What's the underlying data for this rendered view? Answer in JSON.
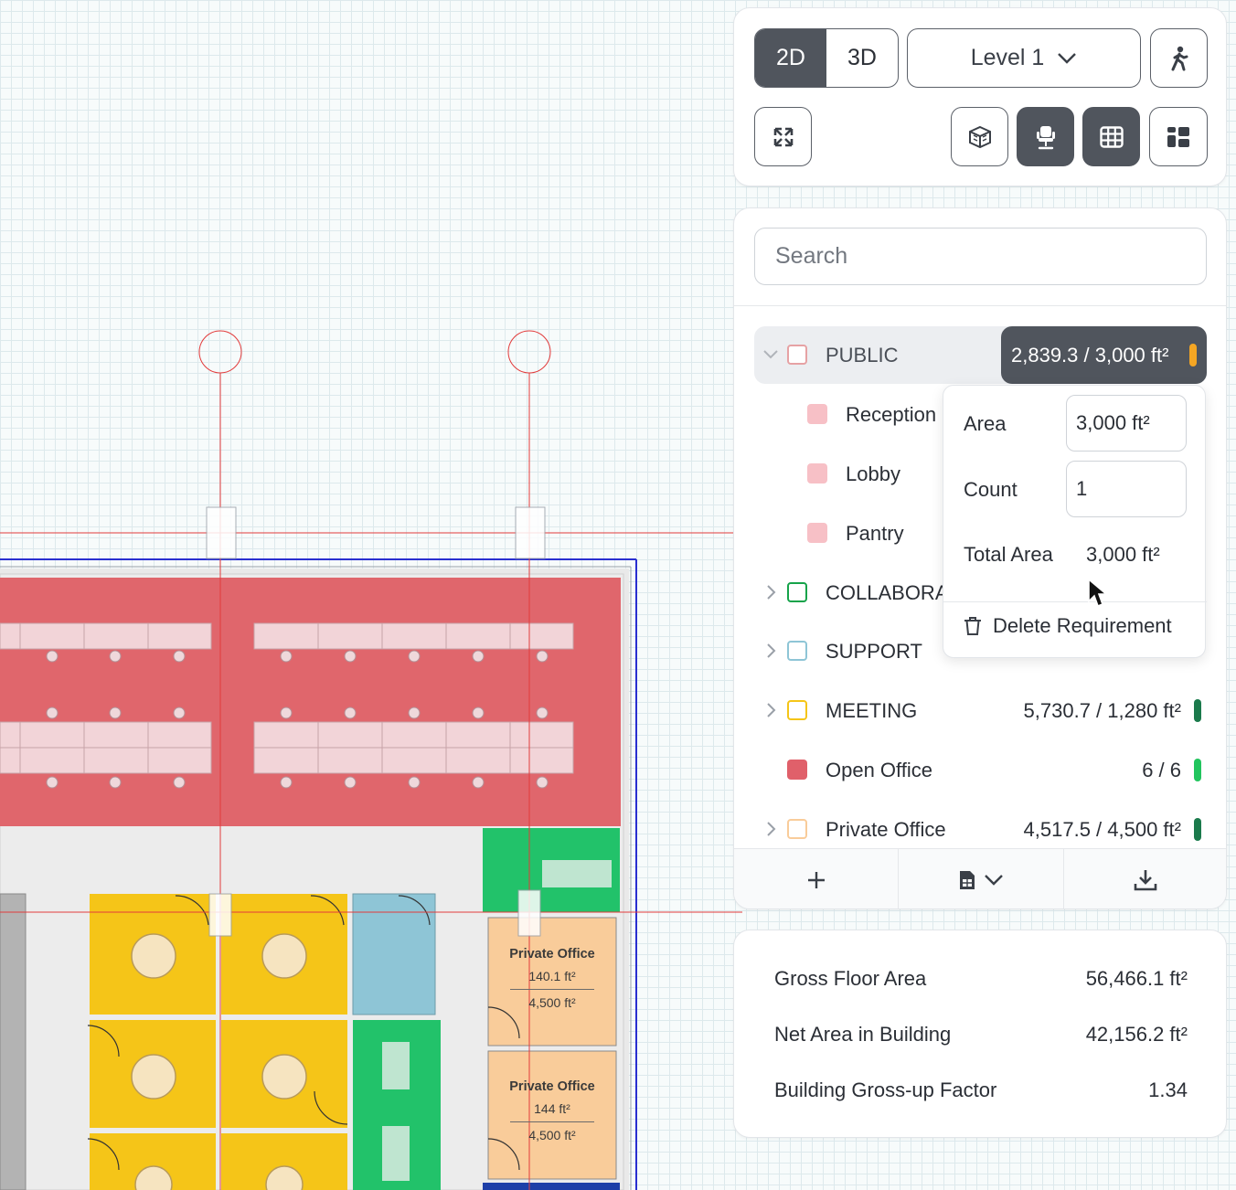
{
  "plan": {
    "labels": [
      {
        "title": "Private Office",
        "actual": "140.1 ft²",
        "target": "4,500 ft²"
      },
      {
        "title": "Private Office",
        "actual": "144 ft²",
        "target": "4,500 ft²"
      }
    ]
  },
  "toolbar": {
    "view_2d": "2D",
    "view_3d": "3D",
    "level": "Level 1",
    "icons": [
      "walk-icon",
      "expand-icon",
      "cube-icon",
      "chair-icon",
      "grid-icon",
      "layout-icon"
    ]
  },
  "search": {
    "placeholder": "Search"
  },
  "list": {
    "public": {
      "label": "PUBLIC",
      "value": "2,839.3 / 3,000 ft²",
      "swatch": "#e6a2a4",
      "bar": "#f5a623"
    },
    "children": [
      {
        "label": "Reception",
        "swatch": "#f7c0c6"
      },
      {
        "label": "Lobby",
        "swatch": "#f7c0c6"
      },
      {
        "label": "Pantry",
        "swatch": "#f7c0c6"
      }
    ],
    "collaboration": {
      "label": "COLLABORA",
      "swatch": "#16a34a"
    },
    "support": {
      "label": "SUPPORT",
      "swatch": "#8ec5d6"
    },
    "meeting": {
      "label": "MEETING",
      "value": "5,730.7 / 1,280 ft²",
      "swatch": "#f5c518",
      "bar": "#1b7a4c"
    },
    "open_office": {
      "label": "Open Office",
      "value": "6 / 6",
      "swatch": "#e0606a",
      "bar": "#22c55e"
    },
    "private_office": {
      "label": "Private Office",
      "value": "4,517.5 / 4,500 ft²",
      "swatch": "#f9cc9a",
      "bar": "#1b7a4c"
    }
  },
  "popover": {
    "area_label": "Area",
    "area_value": "3,000 ft²",
    "count_label": "Count",
    "count_value": "1",
    "total_label": "Total Area",
    "total_value": "3,000 ft²",
    "delete_label": "Delete Requirement"
  },
  "stats": [
    {
      "label": "Gross Floor Area",
      "value": "56,466.1 ft²"
    },
    {
      "label": "Net Area in Building",
      "value": "42,156.2 ft²"
    },
    {
      "label": "Building Gross-up Factor",
      "value": "1.34"
    }
  ]
}
